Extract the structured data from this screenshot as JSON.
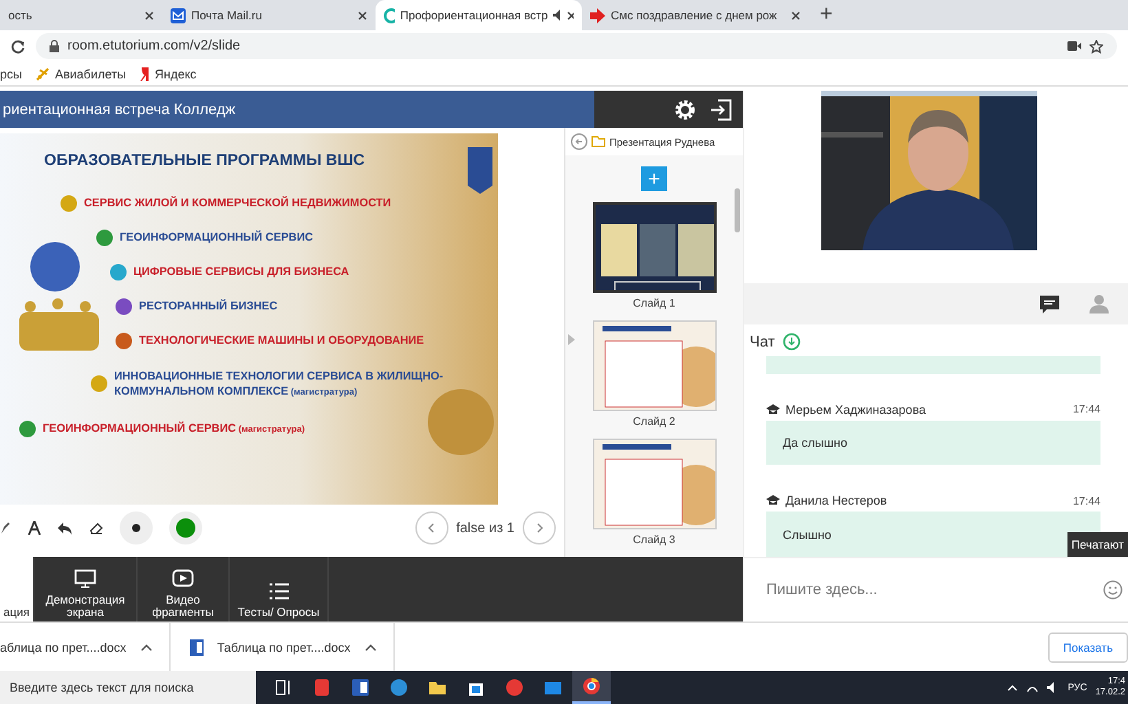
{
  "browser": {
    "tabs": [
      {
        "title": "ость",
        "selected": false
      },
      {
        "title": "Почта Mail.ru",
        "selected": false
      },
      {
        "title": "Профориентационная встр",
        "selected": true
      },
      {
        "title": "Смс поздравление с днем рож",
        "selected": false
      }
    ],
    "new_tab": "+",
    "address": "room.etutorium.com/v2/slide",
    "bookmarks": [
      "рсы",
      "Авиабилеты",
      "Яндекс"
    ]
  },
  "room": {
    "title": "риентационная встреча Колледж",
    "slide": {
      "heading": "ОБРАЗОВАТЕЛЬНЫЕ ПРОГРАММЫ ВШС",
      "items": [
        {
          "text": "СЕРВИС ЖИЛОЙ И КОММЕРЧЕСКОЙ НЕДВИЖИМОСТИ",
          "emphasis": true,
          "color": "#d4a814"
        },
        {
          "text": "ГЕОИНФОРМАЦИОННЫЙ СЕРВИС",
          "emphasis": false,
          "color": "#2e9a3e"
        },
        {
          "text": "ЦИФРОВЫЕ СЕРВИСЫ ДЛЯ БИЗНЕСА",
          "emphasis": true,
          "color": "#27a8cc"
        },
        {
          "text": "РЕСТОРАННЫЙ БИЗНЕС",
          "emphasis": false,
          "color": "#7a4cc0"
        },
        {
          "text": "ТЕХНОЛОГИЧЕСКИЕ МАШИНЫ И ОБОРУДОВАНИЕ",
          "emphasis": true,
          "color": "#c85a1c"
        },
        {
          "text": "ИННОВАЦИОННЫЕ ТЕХНОЛОГИИ СЕРВИСА В ЖИЛИЩНО-КОММУНАЛЬНОМ КОМПЛЕКСЕ",
          "note": "(магистратура)",
          "emphasis": false,
          "color": "#d4a814"
        },
        {
          "text": "ГЕОИНФОРМАЦИОННЫЙ СЕРВИС",
          "note": "(магистратура)",
          "emphasis": true,
          "color": "#2e9a3e"
        }
      ]
    },
    "pager": "false из 1",
    "presentation": {
      "name": "Презентация Руднева",
      "add": "+",
      "slides": [
        {
          "label": "Слайд 1",
          "selected": true
        },
        {
          "label": "Слайд 2",
          "selected": false
        },
        {
          "label": "Слайд 3",
          "selected": false
        }
      ]
    },
    "toolbar": [
      {
        "label": "ация",
        "selected": true
      },
      {
        "label": "Демонстрация экрана",
        "selected": false
      },
      {
        "label": "Видео фрагменты",
        "selected": false
      },
      {
        "label": "Тесты/ Опросы",
        "selected": false
      }
    ],
    "chat": {
      "title": "Чат",
      "messages": [
        {
          "author": "Мерьем Хаджиназарова",
          "time": "17:44",
          "text": "Да слышно"
        },
        {
          "author": "Данила Нестеров",
          "time": "17:44",
          "text": "Слышно"
        }
      ],
      "placeholder": "Пишите здесь...",
      "tooltip": "Печатают"
    }
  },
  "downloads": {
    "files": [
      "аблица по прет....docx",
      "Таблица по прет....docx"
    ],
    "show": "Показать"
  },
  "taskbar": {
    "search_placeholder": "Введите здесь текст для поиска",
    "language": "РУС",
    "time": "17:4",
    "date": "17.02.2"
  }
}
